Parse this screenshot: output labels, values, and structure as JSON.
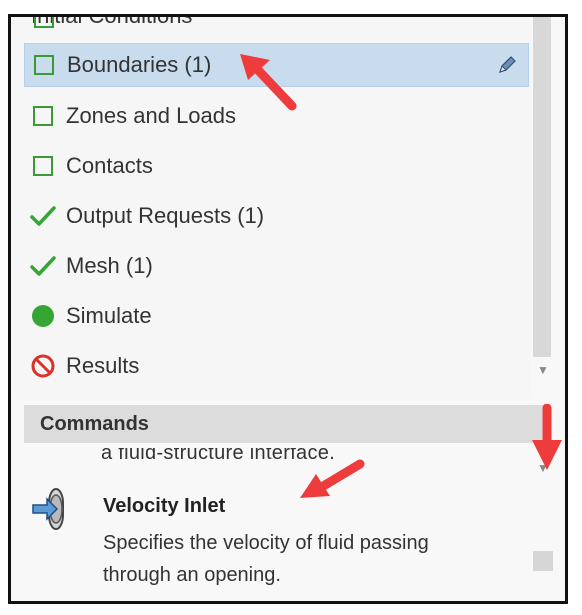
{
  "tree": {
    "partial_label": "Initial Conditions",
    "items": [
      {
        "label": "Boundaries (1)",
        "status": "incomplete",
        "selected": true
      },
      {
        "label": "Zones and Loads",
        "status": "incomplete"
      },
      {
        "label": "Contacts",
        "status": "incomplete"
      },
      {
        "label": "Output Requests (1)",
        "status": "complete"
      },
      {
        "label": "Mesh (1)",
        "status": "complete"
      },
      {
        "label": "Simulate",
        "status": "ready"
      },
      {
        "label": "Results",
        "status": "unavailable"
      }
    ]
  },
  "commands": {
    "header": "Commands",
    "cut_description": "a fluid-structure interface.",
    "item": {
      "title": "Velocity Inlet",
      "description": "Specifies the velocity of fluid passing through an opening."
    }
  },
  "colors": {
    "selection": "#c9dcee",
    "check_green": "#35a534",
    "annotation_red": "#ee3b3b"
  }
}
